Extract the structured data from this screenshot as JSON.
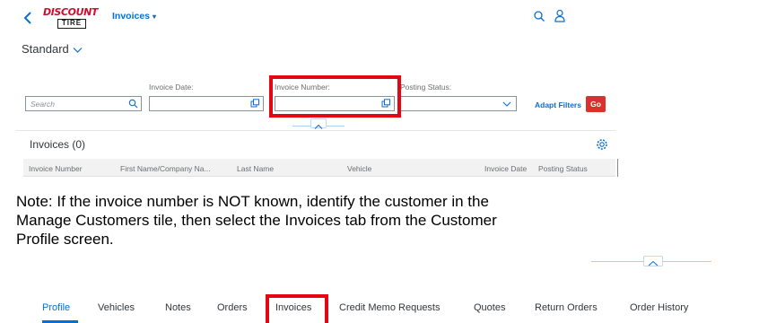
{
  "shell": {
    "logo_line1": "DISCOUNT",
    "logo_line2": "TIRE",
    "app_title": "Invoices",
    "title_caret": "▾"
  },
  "variant": {
    "label": "Standard"
  },
  "filters": {
    "search_placeholder": "Search",
    "invoice_date_label": "Invoice Date:",
    "invoice_number_label": "Invoice Number:",
    "posting_status_label": "Posting Status:",
    "adapt_filters": "Adapt Filters",
    "go": "Go"
  },
  "table": {
    "title": "Invoices (0)",
    "columns": [
      "Invoice Number",
      "First Name/Company Na...",
      "Last Name",
      "Vehicle",
      "Invoice Date",
      "Posting Status"
    ]
  },
  "note": {
    "line1": "Note: If the invoice number is NOT known, identify the customer in the",
    "line2": "Manage Customers tile, then select the Invoices tab from the Customer",
    "line3": "Profile screen."
  },
  "tabs": [
    {
      "label": "Profile",
      "active": true
    },
    {
      "label": "Vehicles"
    },
    {
      "label": "Notes"
    },
    {
      "label": "Orders"
    },
    {
      "label": "Invoices",
      "highlighted": true
    },
    {
      "label": "Credit Memo Requests"
    },
    {
      "label": "Quotes"
    },
    {
      "label": "Return Orders"
    },
    {
      "label": "Order History"
    }
  ],
  "colors": {
    "accent": "#0a6ed1",
    "go_button": "#d9312d",
    "callout": "#e30613",
    "brand_red": "#c8102e"
  }
}
